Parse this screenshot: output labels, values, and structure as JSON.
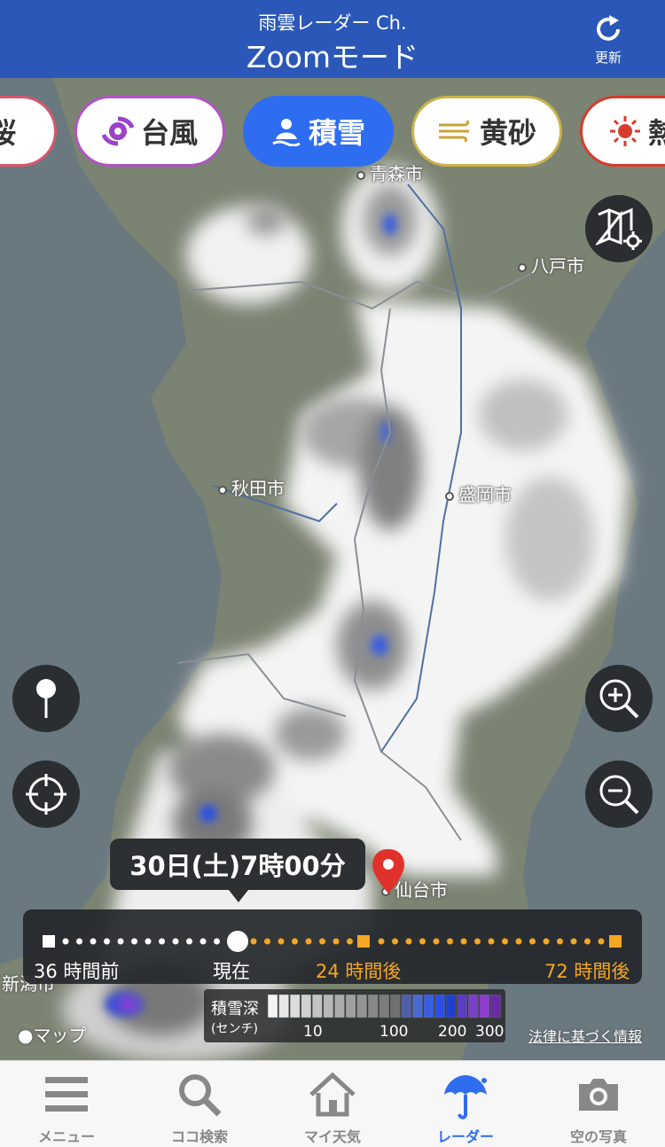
{
  "header": {
    "subtitle": "雨雲レーダー Ch.",
    "title": "Zoomモード",
    "refresh_label": "更新"
  },
  "chips": [
    {
      "label": "桜",
      "icon": "sakura-icon",
      "border": "#d9576b"
    },
    {
      "label": "台風",
      "icon": "typhoon-icon",
      "border": "#b153c4"
    },
    {
      "label": "積雪",
      "icon": "snow-icon",
      "border": "#2f6df0",
      "active": true
    },
    {
      "label": "黄砂",
      "icon": "yellow-dust-icon",
      "border": "#c9b24a"
    },
    {
      "label": "熱",
      "icon": "heat-icon",
      "border": "#d63b2b"
    }
  ],
  "cities": [
    {
      "name": "青森市"
    },
    {
      "name": "八戸市"
    },
    {
      "name": "秋田市"
    },
    {
      "name": "盛岡市"
    },
    {
      "name": "仙台市"
    },
    {
      "name": "新潟市"
    }
  ],
  "tooltip": {
    "time": "30日(土)7時00分"
  },
  "timeline": {
    "labels": {
      "past": "36 時間前",
      "now": "現在",
      "plus24": "24 時間後",
      "plus72": "72 時間後"
    },
    "colors": {
      "past": "#ffffff",
      "future": "#f5a623"
    }
  },
  "legend": {
    "title": "積雪深",
    "unit": "(センチ)",
    "ticks": [
      "10",
      "100",
      "200",
      "300"
    ],
    "colors": [
      "#f4f4f4",
      "#e8e8e8",
      "#dcdcdc",
      "#d0d0d0",
      "#c4c4c4",
      "#b8b8b8",
      "#acacac",
      "#a0a0a0",
      "#949494",
      "#888888",
      "#7c7c7c",
      "#707070",
      "#5060a8",
      "#4a6ad0",
      "#3a5ee0",
      "#2b50e8",
      "#2040d0",
      "#5a3ec0",
      "#7a3fc8",
      "#8c3ecf",
      "#6a2aa8"
    ]
  },
  "map_attribution": "マップ",
  "legal_link": "法律に基づく情報",
  "nav": [
    {
      "label": "メニュー",
      "icon": "menu-icon"
    },
    {
      "label": "ココ検索",
      "icon": "search-icon"
    },
    {
      "label": "マイ天気",
      "icon": "home-icon"
    },
    {
      "label": "レーダー",
      "icon": "umbrella-icon",
      "active": true
    },
    {
      "label": "空の写真",
      "icon": "camera-icon"
    }
  ]
}
